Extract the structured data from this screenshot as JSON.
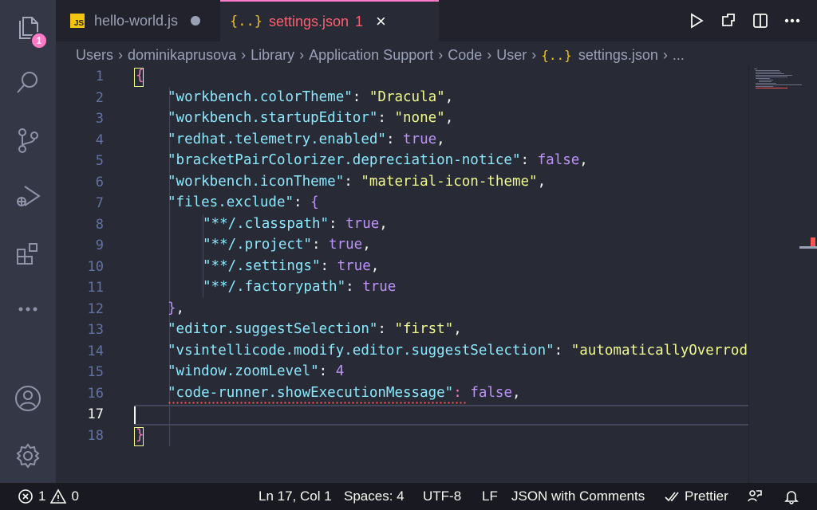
{
  "tabs": [
    {
      "label": "hello-world.js",
      "icon": "js-file-icon",
      "modified": true
    },
    {
      "label": "settings.json",
      "icon": "json-file-icon",
      "problems": "1",
      "active": true
    }
  ],
  "icons": {
    "js": "JS",
    "json": "{..}"
  },
  "breadcrumb": [
    "Users",
    "dominikaprusova",
    "Library",
    "Application Support",
    "Code",
    "User",
    "settings.json",
    "..."
  ],
  "activity": {
    "badge": "1"
  },
  "editor": {
    "line_numbers": [
      "1",
      "2",
      "3",
      "4",
      "5",
      "6",
      "7",
      "8",
      "9",
      "10",
      "11",
      "12",
      "13",
      "14",
      "15",
      "16",
      "17",
      "18"
    ],
    "current_line": "17",
    "keys": {
      "k2": "\"workbench.colorTheme\"",
      "v2": "\"Dracula\"",
      "k3": "\"workbench.startupEditor\"",
      "v3": "\"none\"",
      "k4": "\"redhat.telemetry.enabled\"",
      "v4": "true",
      "k5": "\"bracketPairColorizer.depreciation-notice\"",
      "v5": "false",
      "k6": "\"workbench.iconTheme\"",
      "v6": "\"material-icon-theme\"",
      "k7": "\"files.exclude\"",
      "k8": "\"**/.classpath\"",
      "v8": "true",
      "k9": "\"**/.project\"",
      "v9": "true",
      "k10": "\"**/.settings\"",
      "v10": "true",
      "k11": "\"**/.factorypath\"",
      "v11": "true",
      "k13": "\"editor.suggestSelection\"",
      "v13": "\"first\"",
      "k14": "\"vsintellicode.modify.editor.suggestSelection\"",
      "v14": "\"automaticallyOverrod",
      "k15": "\"window.zoomLevel\"",
      "v15": "4",
      "k16": "\"code-runner.showExecutionMessage\"",
      "v16": "false"
    }
  },
  "status": {
    "errors": "1",
    "warnings": "0",
    "position": "Ln 17, Col 1",
    "spaces": "Spaces: 4",
    "encoding": "UTF-8",
    "eol": "LF",
    "language": "JSON with Comments",
    "prettier": "Prettier"
  },
  "colors": {
    "accent": "#ff79c6",
    "error": "#ff5555",
    "string": "#f1fa8c",
    "key": "#8be9fd",
    "bool": "#bd93f9"
  }
}
